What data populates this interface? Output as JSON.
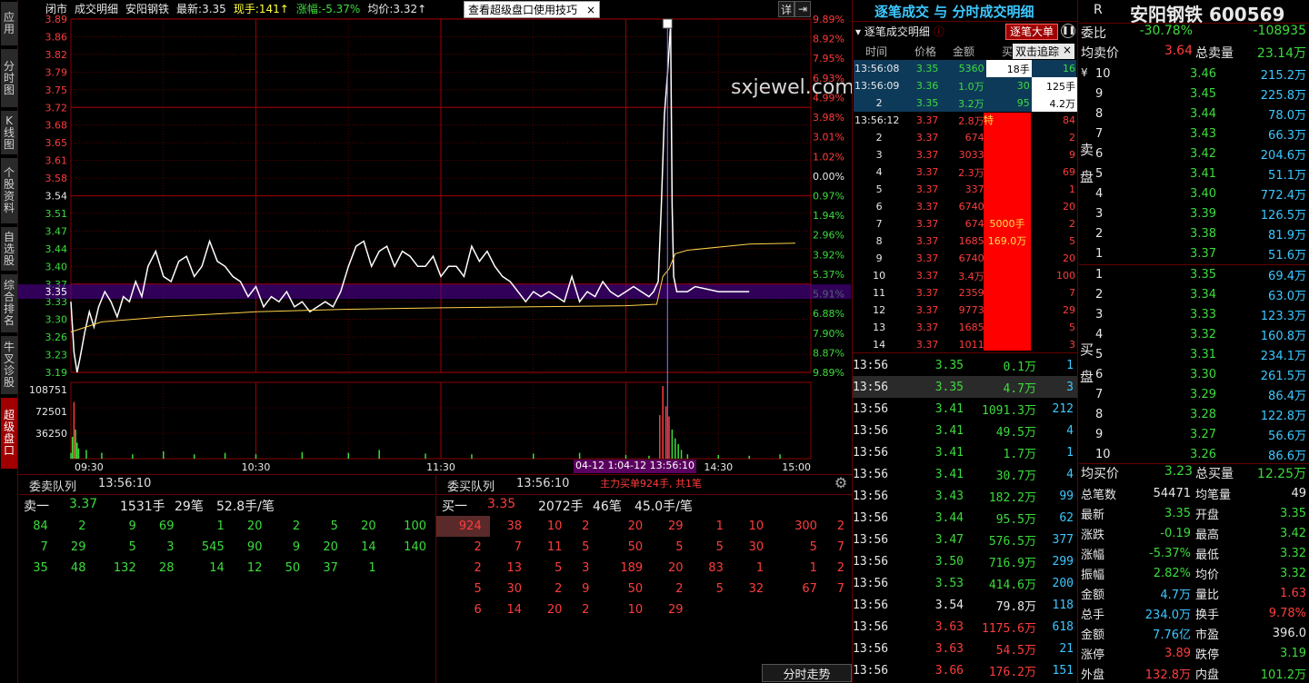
{
  "left_tabs": [
    {
      "label": "应用",
      "active": false
    },
    {
      "label": "分时图",
      "active": false
    },
    {
      "label": "K线图",
      "active": false
    },
    {
      "label": "个股资料",
      "active": false
    },
    {
      "label": "自选股",
      "active": false
    },
    {
      "label": "综合排名",
      "active": false
    },
    {
      "label": "牛叉诊股",
      "active": false
    },
    {
      "label": "超级盘口",
      "active": true
    }
  ],
  "topbar": {
    "status": "闭市",
    "title": "成交明细",
    "name": "安阳钢铁",
    "latest_label": "最新:",
    "latest": "3.35",
    "vol_label": "现手:",
    "vol": "141↑",
    "chg_label": "涨幅:",
    "chg": "-5.37%",
    "avg_label": "均价:",
    "avg": "3.32↑"
  },
  "tip": {
    "text": "查看超级盘口使用技巧",
    "close": "×"
  },
  "chart_buttons": {
    "detail": "详",
    "arrow": "⇥"
  },
  "watermark": "sxjewel.com",
  "chart_data": {
    "type": "line",
    "y_ticks": [
      "3.89",
      "3.86",
      "3.82",
      "3.79",
      "3.75",
      "3.72",
      "3.68",
      "3.65",
      "3.61",
      "3.58",
      "3.54",
      "3.51",
      "3.47",
      "3.44",
      "3.40",
      "3.37",
      "3.33",
      "3.30",
      "3.26",
      "3.23",
      "3.19"
    ],
    "current_price_label": "3.35",
    "pct_ticks": [
      "9.89%",
      "8.92%",
      "7.95%",
      "6.93%",
      "4.99%",
      "3.98%",
      "3.01%",
      "1.02%",
      "0.00%",
      "0.97%",
      "1.94%",
      "2.96%",
      "3.92%",
      "5.37%",
      "5.91%",
      "6.88%",
      "7.90%",
      "8.87%",
      "9.89%"
    ],
    "vol_ticks": [
      "108751",
      "72501",
      "36250"
    ],
    "x_ticks": [
      "09:30",
      "10:30",
      "11:30",
      "13:30",
      "14:30",
      "15:00"
    ],
    "ylim": [
      3.19,
      3.89
    ],
    "prev_close": 3.54,
    "series": [
      {
        "name": "price",
        "color": "#ffffff",
        "points": [
          [
            0,
            3.33
          ],
          [
            2,
            3.23
          ],
          [
            4,
            3.19
          ],
          [
            6,
            3.22
          ],
          [
            9,
            3.27
          ],
          [
            12,
            3.31
          ],
          [
            15,
            3.28
          ],
          [
            18,
            3.32
          ],
          [
            22,
            3.35
          ],
          [
            26,
            3.33
          ],
          [
            30,
            3.3
          ],
          [
            34,
            3.34
          ],
          [
            38,
            3.33
          ],
          [
            42,
            3.37
          ],
          [
            46,
            3.34
          ],
          [
            50,
            3.4
          ],
          [
            55,
            3.43
          ],
          [
            60,
            3.38
          ],
          [
            65,
            3.37
          ],
          [
            70,
            3.41
          ],
          [
            75,
            3.42
          ],
          [
            80,
            3.38
          ],
          [
            85,
            3.4
          ],
          [
            90,
            3.45
          ],
          [
            95,
            3.41
          ],
          [
            100,
            3.4
          ],
          [
            105,
            3.38
          ],
          [
            110,
            3.37
          ],
          [
            115,
            3.34
          ],
          [
            120,
            3.36
          ],
          [
            125,
            3.32
          ],
          [
            130,
            3.34
          ],
          [
            135,
            3.33
          ],
          [
            140,
            3.35
          ],
          [
            145,
            3.32
          ],
          [
            150,
            3.33
          ],
          [
            155,
            3.31
          ],
          [
            160,
            3.32
          ],
          [
            165,
            3.33
          ],
          [
            170,
            3.32
          ],
          [
            175,
            3.35
          ],
          [
            180,
            3.4
          ],
          [
            185,
            3.44
          ],
          [
            190,
            3.45
          ],
          [
            195,
            3.4
          ],
          [
            200,
            3.43
          ],
          [
            205,
            3.44
          ],
          [
            210,
            3.4
          ],
          [
            215,
            3.43
          ],
          [
            220,
            3.42
          ],
          [
            225,
            3.4
          ],
          [
            230,
            3.4
          ],
          [
            235,
            3.42
          ],
          [
            240,
            3.38
          ],
          [
            245,
            3.4
          ],
          [
            250,
            3.4
          ],
          [
            255,
            3.38
          ],
          [
            260,
            3.44
          ],
          [
            265,
            3.41
          ],
          [
            270,
            3.43
          ],
          [
            275,
            3.4
          ],
          [
            280,
            3.38
          ],
          [
            285,
            3.37
          ],
          [
            290,
            3.35
          ],
          [
            295,
            3.33
          ],
          [
            300,
            3.35
          ],
          [
            305,
            3.34
          ],
          [
            310,
            3.35
          ],
          [
            315,
            3.34
          ],
          [
            320,
            3.33
          ],
          [
            325,
            3.38
          ],
          [
            330,
            3.33
          ],
          [
            335,
            3.35
          ],
          [
            340,
            3.34
          ],
          [
            345,
            3.37
          ],
          [
            350,
            3.35
          ],
          [
            355,
            3.34
          ],
          [
            360,
            3.35
          ],
          [
            365,
            3.36
          ],
          [
            370,
            3.35
          ],
          [
            375,
            3.34
          ],
          [
            378,
            3.35
          ],
          [
            381,
            3.37
          ],
          [
            383,
            3.52
          ],
          [
            385,
            3.7
          ],
          [
            387,
            3.78
          ],
          [
            389,
            3.88
          ],
          [
            390,
            3.52
          ],
          [
            391,
            3.38
          ],
          [
            393,
            3.35
          ],
          [
            395,
            3.35
          ],
          [
            400,
            3.35
          ],
          [
            405,
            3.36
          ],
          [
            420,
            3.35
          ],
          [
            440,
            3.35
          ]
        ]
      },
      {
        "name": "avg",
        "color": "#ffd24a",
        "points": [
          [
            0,
            3.27
          ],
          [
            20,
            3.29
          ],
          [
            60,
            3.3
          ],
          [
            120,
            3.31
          ],
          [
            180,
            3.315
          ],
          [
            240,
            3.318
          ],
          [
            300,
            3.32
          ],
          [
            360,
            3.322
          ],
          [
            380,
            3.325
          ],
          [
            384,
            3.38
          ],
          [
            388,
            3.395
          ],
          [
            392,
            3.425
          ],
          [
            400,
            3.432
          ],
          [
            440,
            3.444
          ],
          [
            470,
            3.446
          ]
        ]
      }
    ],
    "volumes": [
      [
        0,
        8
      ],
      [
        1,
        30
      ],
      [
        2,
        78
      ],
      [
        3,
        40
      ],
      [
        4,
        22
      ],
      [
        5,
        14
      ],
      [
        10,
        12
      ],
      [
        20,
        8
      ],
      [
        40,
        6
      ],
      [
        60,
        10
      ],
      [
        80,
        6
      ],
      [
        100,
        8
      ],
      [
        120,
        6
      ],
      [
        150,
        9
      ],
      [
        180,
        8
      ],
      [
        200,
        12
      ],
      [
        230,
        7
      ],
      [
        260,
        6
      ],
      [
        300,
        7
      ],
      [
        330,
        8
      ],
      [
        360,
        5
      ],
      [
        375,
        4
      ],
      [
        382,
        60
      ],
      [
        384,
        100
      ],
      [
        386,
        72
      ],
      [
        388,
        58
      ],
      [
        390,
        40
      ],
      [
        392,
        28
      ],
      [
        394,
        20
      ],
      [
        396,
        12
      ],
      [
        400,
        6
      ],
      [
        420,
        5
      ],
      [
        440,
        4
      ],
      [
        460,
        6
      ]
    ],
    "bottom_label_1": "04-12 1:04-12 13:56:10",
    "bottom_label_2": "主力买单924手, 共1笔"
  },
  "sell_queue": {
    "title": "委卖队列",
    "time": "13:56:10",
    "level_label": "卖一",
    "price": "3.37",
    "lots": "1531手",
    "count": "29笔",
    "avg": "52.8手/笔",
    "rows": [
      [
        "84",
        "2",
        "9",
        "69",
        "1",
        "20",
        "2",
        "5",
        "20",
        "100"
      ],
      [
        "7",
        "29",
        "5",
        "3",
        "545",
        "90",
        "9",
        "20",
        "14",
        "140"
      ],
      [
        "35",
        "48",
        "132",
        "28",
        "14",
        "12",
        "50",
        "37",
        "1",
        ""
      ]
    ]
  },
  "buy_queue": {
    "title": "委买队列",
    "time": "13:56:10",
    "level_label": "买一",
    "price": "3.35",
    "lots": "2072手",
    "count": "46笔",
    "avg": "45.0手/笔",
    "rows": [
      [
        "924",
        "38",
        "10",
        "2",
        "20",
        "29",
        "1",
        "10",
        "300",
        "2"
      ],
      [
        "2",
        "7",
        "11",
        "5",
        "50",
        "5",
        "5",
        "30",
        "5",
        "7"
      ],
      [
        "2",
        "13",
        "5",
        "3",
        "189",
        "20",
        "83",
        "1",
        "1",
        "2"
      ],
      [
        "5",
        "30",
        "2",
        "9",
        "50",
        "2",
        "5",
        "32",
        "67",
        "7"
      ],
      [
        "6",
        "14",
        "20",
        "2",
        "10",
        "29",
        "",
        "",
        "",
        ""
      ]
    ]
  },
  "tick_panel": {
    "header": "逐笔成交 与 分时成交明细",
    "tab": "逐笔成交明细",
    "big_btn": "逐笔大单",
    "popup": "双击追踪",
    "cols": [
      "时间",
      "价格",
      "金额",
      "买"
    ],
    "rows": [
      [
        "13:56:08",
        "3.35",
        "5360",
        "18手",
        "16"
      ],
      [
        "13:56:09",
        "3.36",
        "1.0万",
        "30",
        "125手"
      ],
      [
        "2",
        "3.35",
        "3.2万",
        "95",
        "4.2万"
      ],
      [
        "13:56:12",
        "3.37",
        "2.8万",
        "",
        "84"
      ],
      [
        "2",
        "3.37",
        "674",
        "",
        "2"
      ],
      [
        "3",
        "3.37",
        "3033",
        "",
        "9"
      ],
      [
        "4",
        "3.37",
        "2.3万",
        "",
        "69"
      ],
      [
        "5",
        "3.37",
        "337",
        "",
        "1"
      ],
      [
        "6",
        "3.37",
        "6740",
        "",
        "20"
      ],
      [
        "7",
        "3.37",
        "674",
        "",
        "2"
      ],
      [
        "8",
        "3.37",
        "1685",
        "",
        "5"
      ],
      [
        "9",
        "3.37",
        "6740",
        "",
        "20"
      ],
      [
        "10",
        "3.37",
        "3.4万",
        "",
        "100"
      ],
      [
        "11",
        "3.37",
        "2359",
        "",
        "7"
      ],
      [
        "12",
        "3.37",
        "9773",
        "",
        "29"
      ],
      [
        "13",
        "3.37",
        "1685",
        "",
        "5"
      ],
      [
        "14",
        "3.37",
        "1011",
        "",
        "3"
      ]
    ],
    "red_bar_label1": "5000手",
    "red_bar_label2": "169.0万",
    "red_bar_tag": "特"
  },
  "big_trades": [
    [
      "13:56",
      "3.35",
      "0.1万",
      "1"
    ],
    [
      "13:56",
      "3.35",
      "4.7万",
      "3"
    ],
    [
      "13:56",
      "3.41",
      "1091.3万",
      "212"
    ],
    [
      "13:56",
      "3.41",
      "49.5万",
      "4"
    ],
    [
      "13:56",
      "3.41",
      "1.7万",
      "1"
    ],
    [
      "13:56",
      "3.41",
      "30.7万",
      "4"
    ],
    [
      "13:56",
      "3.43",
      "182.2万",
      "99"
    ],
    [
      "13:56",
      "3.44",
      "95.5万",
      "62"
    ],
    [
      "13:56",
      "3.47",
      "576.5万",
      "377"
    ],
    [
      "13:56",
      "3.50",
      "716.9万",
      "299"
    ],
    [
      "13:56",
      "3.53",
      "414.6万",
      "200"
    ],
    [
      "13:56",
      "3.54",
      "79.8万",
      "118"
    ],
    [
      "13:56",
      "3.63",
      "1175.6万",
      "618"
    ],
    [
      "13:56",
      "3.63",
      "54.5万",
      "21"
    ],
    [
      "13:56",
      "3.66",
      "176.2万",
      "151"
    ]
  ],
  "bottom_tab": "分时走势",
  "stock": {
    "mark": "R",
    "name": "安阳钢铁 600569"
  },
  "orderbook": {
    "ratio_label": "委比",
    "ratio": "-30.78%",
    "diff": "-108935",
    "avg_sell_label": "均卖价",
    "avg_sell": "3.64",
    "total_sell_label": "总卖量",
    "total_sell": "23.14万",
    "sell_side_label": "卖盘",
    "buy_side_label": "买盘",
    "sells": [
      [
        "10",
        "3.46",
        "215.2万"
      ],
      [
        "9",
        "3.45",
        "225.8万"
      ],
      [
        "8",
        "3.44",
        "78.0万"
      ],
      [
        "7",
        "3.43",
        "66.3万"
      ],
      [
        "6",
        "3.42",
        "204.6万"
      ],
      [
        "5",
        "3.41",
        "51.1万"
      ],
      [
        "4",
        "3.40",
        "772.4万"
      ],
      [
        "3",
        "3.39",
        "126.5万"
      ],
      [
        "2",
        "3.38",
        "81.9万"
      ],
      [
        "1",
        "3.37",
        "51.6万"
      ]
    ],
    "buys": [
      [
        "1",
        "3.35",
        "69.4万"
      ],
      [
        "2",
        "3.34",
        "63.0万"
      ],
      [
        "3",
        "3.33",
        "123.3万"
      ],
      [
        "4",
        "3.32",
        "160.8万"
      ],
      [
        "5",
        "3.31",
        "234.1万"
      ],
      [
        "6",
        "3.30",
        "261.5万"
      ],
      [
        "7",
        "3.29",
        "86.4万"
      ],
      [
        "8",
        "3.28",
        "122.8万"
      ],
      [
        "9",
        "3.27",
        "56.6万"
      ],
      [
        "10",
        "3.26",
        "86.6万"
      ]
    ],
    "avg_buy_label": "均买价",
    "avg_buy": "3.23",
    "total_buy_label": "总买量",
    "total_buy": "12.25万",
    "stats": [
      [
        "总笔数",
        "54471",
        "均笔量",
        "49"
      ],
      [
        "最新",
        "3.35",
        "开盘",
        "3.35"
      ],
      [
        "涨跌",
        "-0.19",
        "最高",
        "3.42"
      ],
      [
        "涨幅",
        "-5.37%",
        "最低",
        "3.32"
      ],
      [
        "振幅",
        "2.82%",
        "均价",
        "3.32"
      ],
      [
        "金额",
        "4.7万",
        "量比",
        "1.63"
      ],
      [
        "总手",
        "234.0万",
        "换手",
        "9.78%"
      ],
      [
        "金额",
        "7.76亿",
        "市盈",
        "396.0"
      ],
      [
        "涨停",
        "3.89",
        "跌停",
        "3.19"
      ],
      [
        "外盘",
        "132.8万",
        "内盘",
        "101.2万"
      ]
    ]
  },
  "colors": {
    "up": "#ff3c3c",
    "down": "#3cdc3c",
    "grid": "#8a0000",
    "avg": "#ffd24a"
  }
}
